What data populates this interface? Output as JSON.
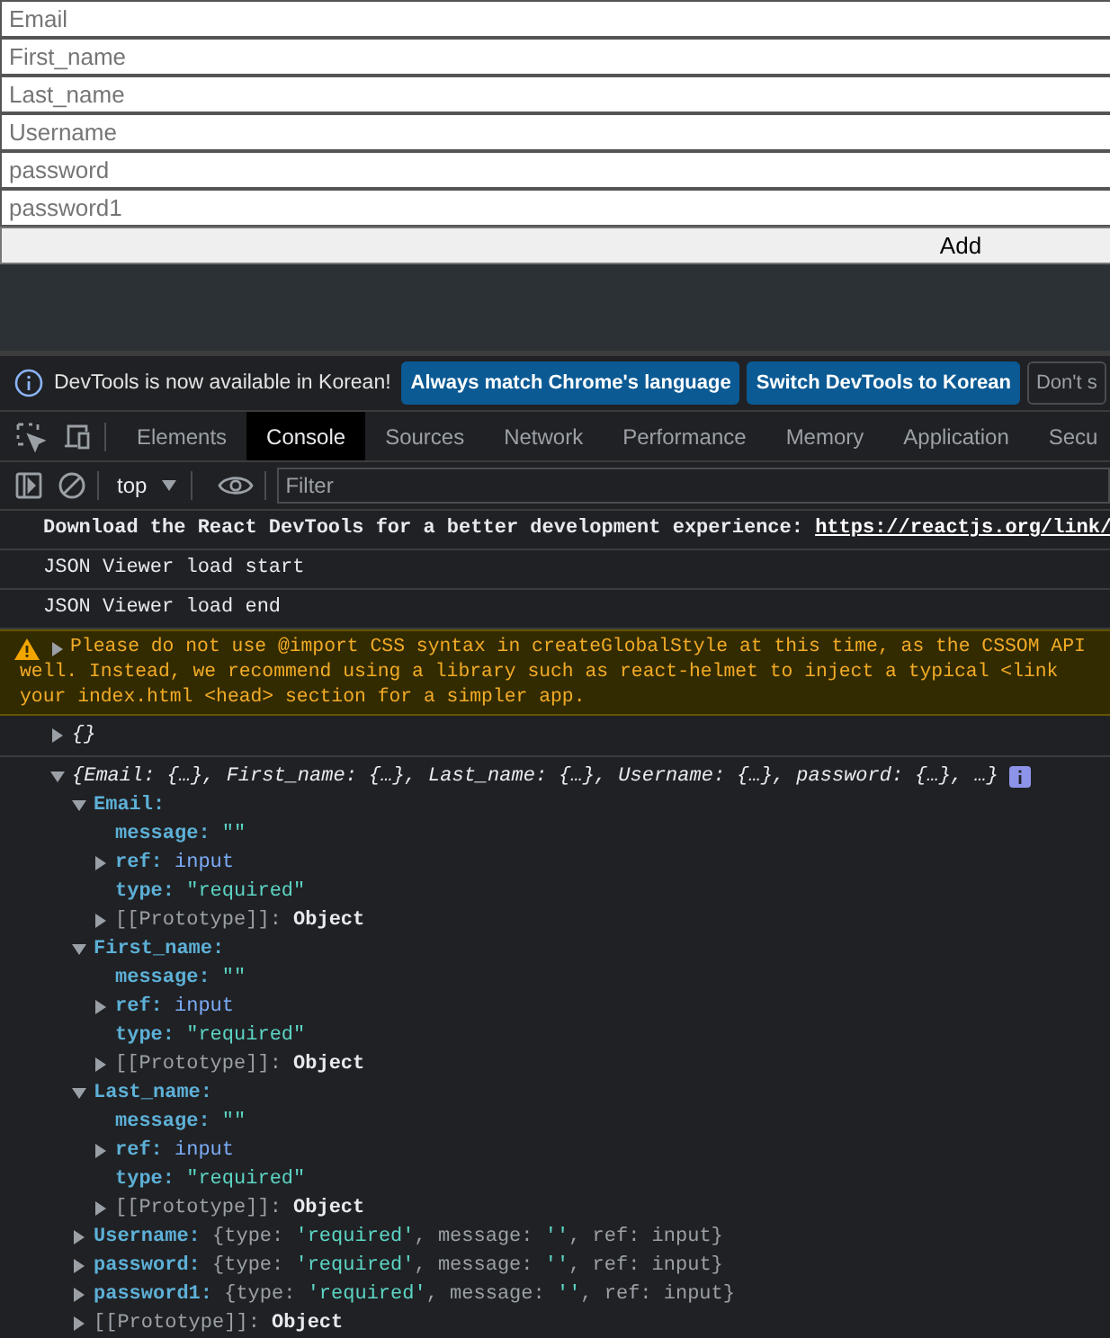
{
  "form": {
    "fields": [
      {
        "placeholder": "Email"
      },
      {
        "placeholder": "First_name"
      },
      {
        "placeholder": "Last_name"
      },
      {
        "placeholder": "Username"
      },
      {
        "placeholder": "password"
      },
      {
        "placeholder": "password1"
      }
    ],
    "button": "Add"
  },
  "infobar": {
    "message": "DevTools is now available in Korean!",
    "buttons": [
      {
        "label": "Always match Chrome's language",
        "kind": "primary"
      },
      {
        "label": "Switch DevTools to Korean",
        "kind": "primary"
      },
      {
        "label": "Don't s",
        "kind": "secondary"
      }
    ]
  },
  "tabs": [
    {
      "label": "Elements",
      "selected": false
    },
    {
      "label": "Console",
      "selected": true
    },
    {
      "label": "Sources",
      "selected": false
    },
    {
      "label": "Network",
      "selected": false
    },
    {
      "label": "Performance",
      "selected": false
    },
    {
      "label": "Memory",
      "selected": false
    },
    {
      "label": "Application",
      "selected": false
    },
    {
      "label": "Secu",
      "selected": false
    }
  ],
  "console_toolbar": {
    "context": "top",
    "filter_placeholder": "Filter"
  },
  "messages": [
    {
      "kind": "log",
      "text": "Download the React DevTools for a better development experience: ",
      "link": "https://reactjs.org/link/"
    },
    {
      "kind": "log",
      "text": "JSON Viewer load start"
    },
    {
      "kind": "log",
      "text": "JSON Viewer load end"
    },
    {
      "kind": "warning",
      "expanded": false,
      "lines": [
        "Please do not use @import CSS syntax in createGlobalStyle at this time, as the CSSOM API",
        "well. Instead, we recommend using a library such as react-helmet to inject a typical <link",
        "your index.html <head> section for a simpler app."
      ]
    },
    {
      "kind": "object",
      "expanded": false,
      "preview": "{}"
    },
    {
      "kind": "object",
      "expanded": true,
      "preview": "{Email: {…}, First_name: {…}, Last_name: {…}, Username: {…}, password: {…}, …}",
      "children": [
        {
          "key": "Email:",
          "internal": false,
          "expanded": true,
          "children": [
            {
              "key": "message:",
              "internal": false,
              "kind": "string",
              "value": "\"\""
            },
            {
              "key": "ref:",
              "internal": false,
              "kind": "element",
              "value": "input",
              "expanded": false
            },
            {
              "key": "type:",
              "internal": false,
              "kind": "string",
              "value": "\"required\""
            },
            {
              "key": "[[Prototype]]:",
              "internal": true,
              "kind": "object",
              "value": "Object",
              "expanded": false
            }
          ]
        },
        {
          "key": "First_name:",
          "internal": false,
          "expanded": true,
          "children": [
            {
              "key": "message:",
              "internal": false,
              "kind": "string",
              "value": "\"\""
            },
            {
              "key": "ref:",
              "internal": false,
              "kind": "element",
              "value": "input",
              "expanded": false
            },
            {
              "key": "type:",
              "internal": false,
              "kind": "string",
              "value": "\"required\""
            },
            {
              "key": "[[Prototype]]:",
              "internal": true,
              "kind": "object",
              "value": "Object",
              "expanded": false
            }
          ]
        },
        {
          "key": "Last_name:",
          "internal": false,
          "expanded": true,
          "children": [
            {
              "key": "message:",
              "internal": false,
              "kind": "string",
              "value": "\"\""
            },
            {
              "key": "ref:",
              "internal": false,
              "kind": "element",
              "value": "input",
              "expanded": false
            },
            {
              "key": "type:",
              "internal": false,
              "kind": "string",
              "value": "\"required\""
            },
            {
              "key": "[[Prototype]]:",
              "internal": true,
              "kind": "object",
              "value": "Object",
              "expanded": false
            }
          ]
        },
        {
          "key": "Username:",
          "internal": false,
          "kind": "summary",
          "value": "{type: 'required', message: '', ref: input}",
          "expanded": false
        },
        {
          "key": "password:",
          "internal": false,
          "kind": "summary",
          "value": "{type: 'required', message: '', ref: input}",
          "expanded": false
        },
        {
          "key": "password1:",
          "internal": false,
          "kind": "summary",
          "value": "{type: 'required', message: '', ref: input}",
          "expanded": false
        },
        {
          "key": "[[Prototype]]:",
          "internal": true,
          "kind": "object",
          "value": "Object",
          "expanded": false
        }
      ]
    }
  ]
}
